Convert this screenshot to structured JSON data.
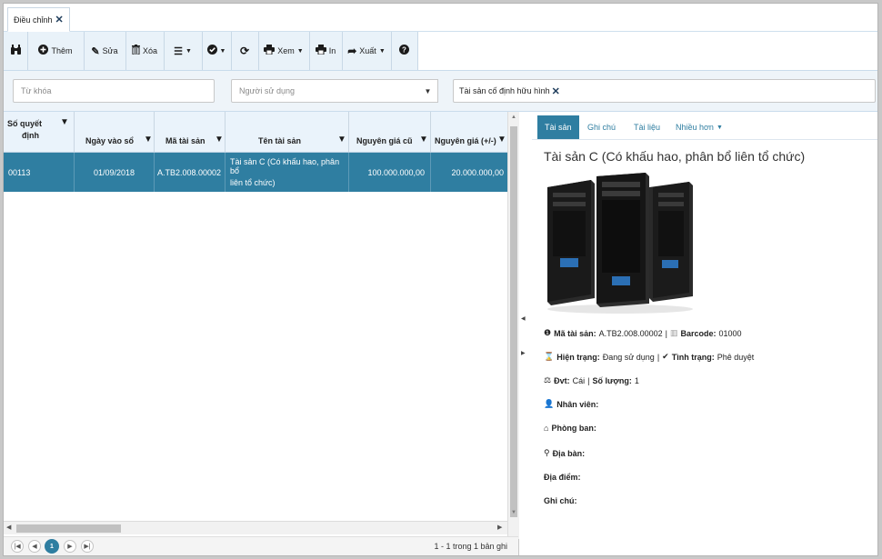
{
  "tab": {
    "label": "Điều chỉnh"
  },
  "toolbar": {
    "them": "Thêm",
    "sua": "Sửa",
    "xoa": "Xóa",
    "xem": "Xem",
    "in": "In",
    "xuat": "Xuất"
  },
  "filters": {
    "keyword_placeholder": "Từ khóa",
    "user_placeholder": "Người sử dụng",
    "chip": "Tài sản cố định hữu hình"
  },
  "grid": {
    "columns": {
      "so_qd_1": "Số quyết",
      "so_qd_2": "định",
      "ngay": "Ngày vào sổ",
      "ma": "Mã tài sản",
      "ten": "Tên tài sản",
      "ngcu": "Nguyên giá cũ",
      "ngdelta": "Nguyên giá (+/-)"
    },
    "rows": [
      {
        "so_qd": "00113",
        "ngay": "01/09/2018",
        "ma": "A.TB2.008.00002",
        "ten_1": "Tài sản C (Có khấu hao, phân bổ",
        "ten_2": "liên tổ chức)",
        "ngcu": "100.000.000,00",
        "ngdelta": "20.000.000,00"
      }
    ],
    "pager": {
      "current": "1",
      "info": "1 - 1 trong 1 bản ghi"
    }
  },
  "detail": {
    "tabs": [
      "Tài sản",
      "Ghi chú",
      "Tài liệu",
      "Nhiều hơn"
    ],
    "title": "Tài sản C (Có khấu hao, phân bổ liên tổ chức)",
    "ma_label": "Mã tài sản:",
    "ma_value": "A.TB2.008.00002",
    "barcode_label": "Barcode:",
    "barcode_value": "01000",
    "hien_trang_label": "Hiện trạng:",
    "hien_trang_value": "Đang sử dụng",
    "tinh_trang_label": "Tình trạng:",
    "tinh_trang_value": "Phê duyệt",
    "dvt_label": "Đvt:",
    "dvt_value": "Cái",
    "so_luong_label": "Số lượng:",
    "so_luong_value": "1",
    "nhan_vien": "Nhân viên:",
    "phong_ban": "Phòng ban:",
    "dia_ban": "Địa bàn:",
    "dia_diem": "Địa điểm:",
    "ghi_chu": "Ghi chú:"
  },
  "colors": {
    "accent": "#2f7ea1",
    "toolbar_bg": "#e9f2f9",
    "header_bg": "#eaf3fb"
  }
}
